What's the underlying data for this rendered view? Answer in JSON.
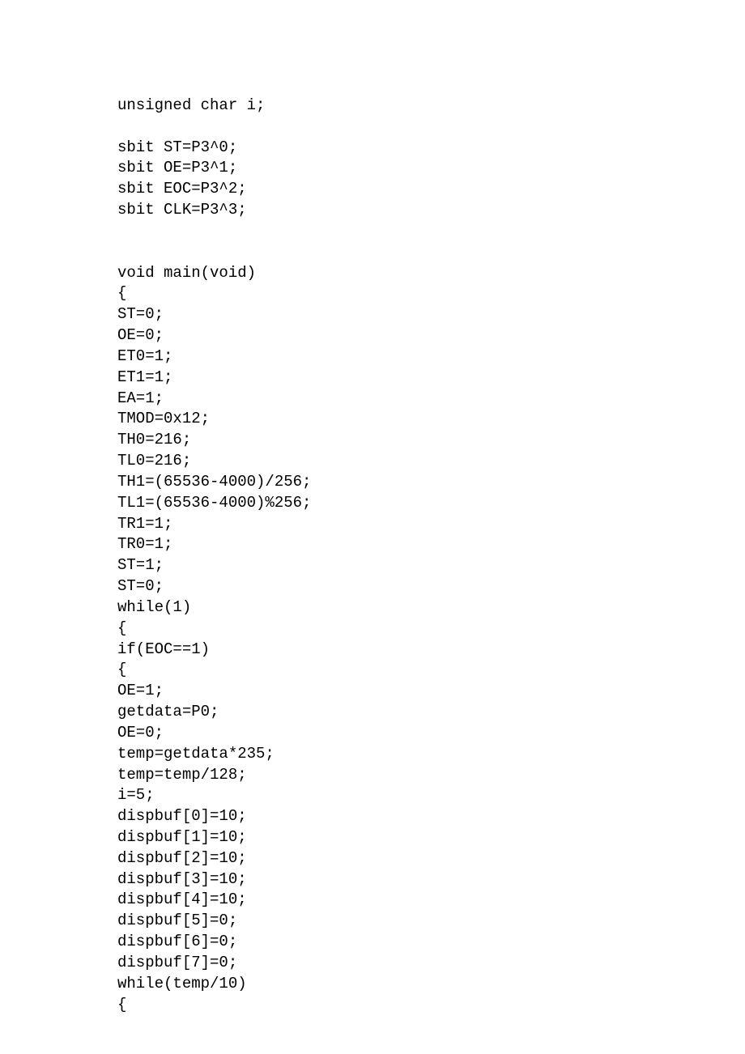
{
  "code": {
    "lines": [
      "unsigned char i;",
      "",
      "sbit ST=P3^0;",
      "sbit OE=P3^1;",
      "sbit EOC=P3^2;",
      "sbit CLK=P3^3;",
      "",
      "",
      "void main(void)",
      "{",
      "ST=0;",
      "OE=0;",
      "ET0=1;",
      "ET1=1;",
      "EA=1;",
      "TMOD=0x12;",
      "TH0=216;",
      "TL0=216;",
      "TH1=(65536-4000)/256;",
      "TL1=(65536-4000)%256;",
      "TR1=1;",
      "TR0=1;",
      "ST=1;",
      "ST=0;",
      "while(1)",
      "{",
      "if(EOC==1)",
      "{",
      "OE=1;",
      "getdata=P0;",
      "OE=0;",
      "temp=getdata*235;",
      "temp=temp/128;",
      "i=5;",
      "dispbuf[0]=10;",
      "dispbuf[1]=10;",
      "dispbuf[2]=10;",
      "dispbuf[3]=10;",
      "dispbuf[4]=10;",
      "dispbuf[5]=0;",
      "dispbuf[6]=0;",
      "dispbuf[7]=0;",
      "while(temp/10)",
      "{"
    ]
  }
}
